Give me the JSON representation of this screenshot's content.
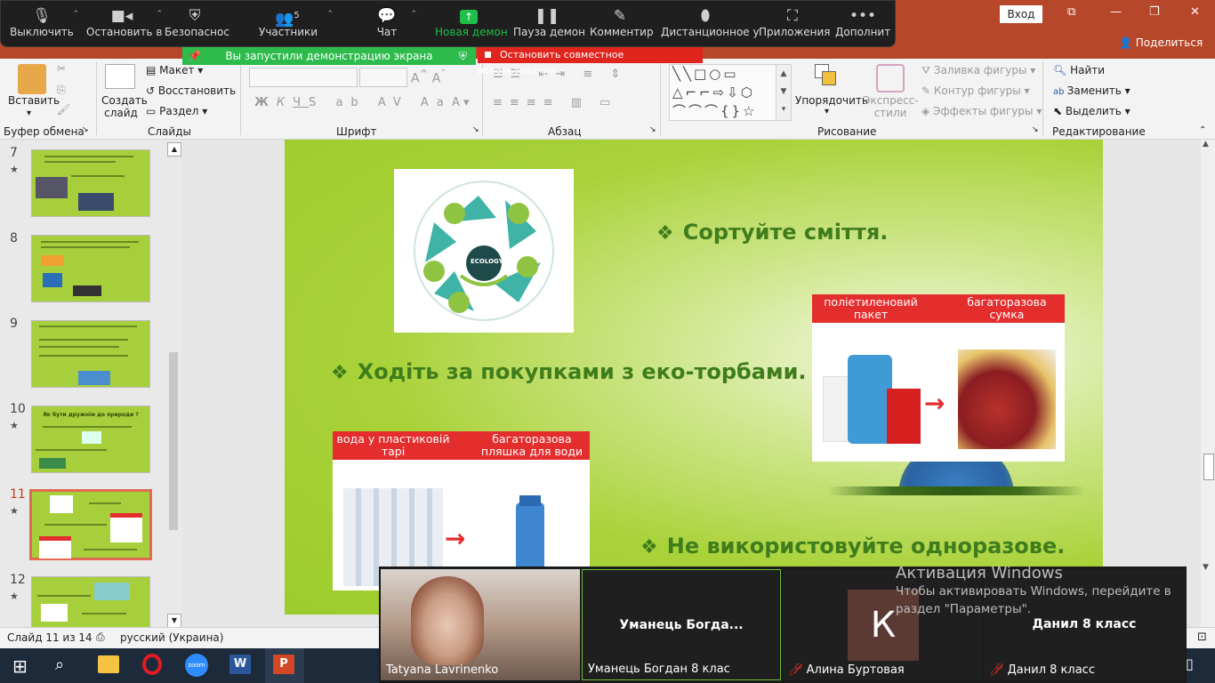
{
  "zoom_toolbar": {
    "items": [
      {
        "label": "Выключить",
        "icon": "microphone-icon"
      },
      {
        "label": "Остановить в",
        "icon": "video-camera-icon"
      },
      {
        "label": "Безопаснос",
        "icon": "shield-icon"
      },
      {
        "label": "Участники",
        "icon": "participants-icon",
        "count": "5"
      },
      {
        "label": "Чат",
        "icon": "chat-icon"
      },
      {
        "label": "Новая демон",
        "icon": "share-screen-icon"
      },
      {
        "label": "Пауза демон",
        "icon": "pause-icon"
      },
      {
        "label": "Комментир",
        "icon": "pen-icon"
      },
      {
        "label": "Дистанционное у",
        "icon": "mouse-icon"
      },
      {
        "label": "Приложения",
        "icon": "apps-icon"
      },
      {
        "label": "Дополнит",
        "icon": "more-icon"
      }
    ],
    "accent": "#1fbf4a"
  },
  "title_bar": {
    "login": "Вход",
    "share": "Поделиться"
  },
  "banners": {
    "sharing": "Вы запустили демонстрацию экрана",
    "stop": "Остановить совместное использование"
  },
  "ribbon": {
    "insert_button": "Вставить",
    "clipboard_group": "Буфер обмена",
    "new_slide": "Создать слайд",
    "layout": "Макет",
    "reset": "Восстановить",
    "section": "Раздел",
    "slides_group": "Слайды",
    "font_group": "Шрифт",
    "paragraph_group": "Абзац",
    "arrange": "Упорядочить",
    "quick_styles": "Экспресс-стили",
    "shape_fill": "Заливка фигуры",
    "shape_outline": "Контур фигуры",
    "shape_effects": "Эффекты фигуры",
    "drawing_group": "Рисование",
    "find": "Найти",
    "replace": "Заменить",
    "select": "Выделить",
    "editing_group": "Редактирование"
  },
  "thumbnails": [
    {
      "num": "7",
      "star": "★"
    },
    {
      "num": "8",
      "star": ""
    },
    {
      "num": "9",
      "star": ""
    },
    {
      "num": "10",
      "star": "★",
      "title": "Як бути дружнім до природи ?"
    },
    {
      "num": "11",
      "star": "★",
      "selected": true
    },
    {
      "num": "12",
      "star": "★"
    }
  ],
  "slide": {
    "bullet1": "Сортуйте сміття.",
    "bullet2": "Ходіть за покупками з еко-торбами.",
    "bullet3": "Не використовуйте одноразове.",
    "bag_left": "поліетиленовий пакет",
    "bag_right": "багаторазова сумка",
    "water_left": "вода у пластиковій тарі",
    "water_right": "багаторазова пляшка для води",
    "ecology_logo": "ECOLOGY"
  },
  "status_bar": {
    "slide_info": "Слайд 11 из 14",
    "language": "русский (Украина)"
  },
  "gallery": {
    "tiles": [
      {
        "name": "Tatyana Lavrinenko",
        "type": "video"
      },
      {
        "name": "Уманець Богдан 8 клас",
        "big": "Уманець  Богда...",
        "muted": false
      },
      {
        "name": "Алина Буртовая",
        "avatar": "К",
        "muted": true
      },
      {
        "name": "Данил 8 класс",
        "big": "Данил 8 класс",
        "muted": true
      }
    ]
  },
  "watermark": {
    "title": "Активация Windows",
    "line": "Чтобы активировать Windows, перейдите в раздел \"Параметры\"."
  }
}
